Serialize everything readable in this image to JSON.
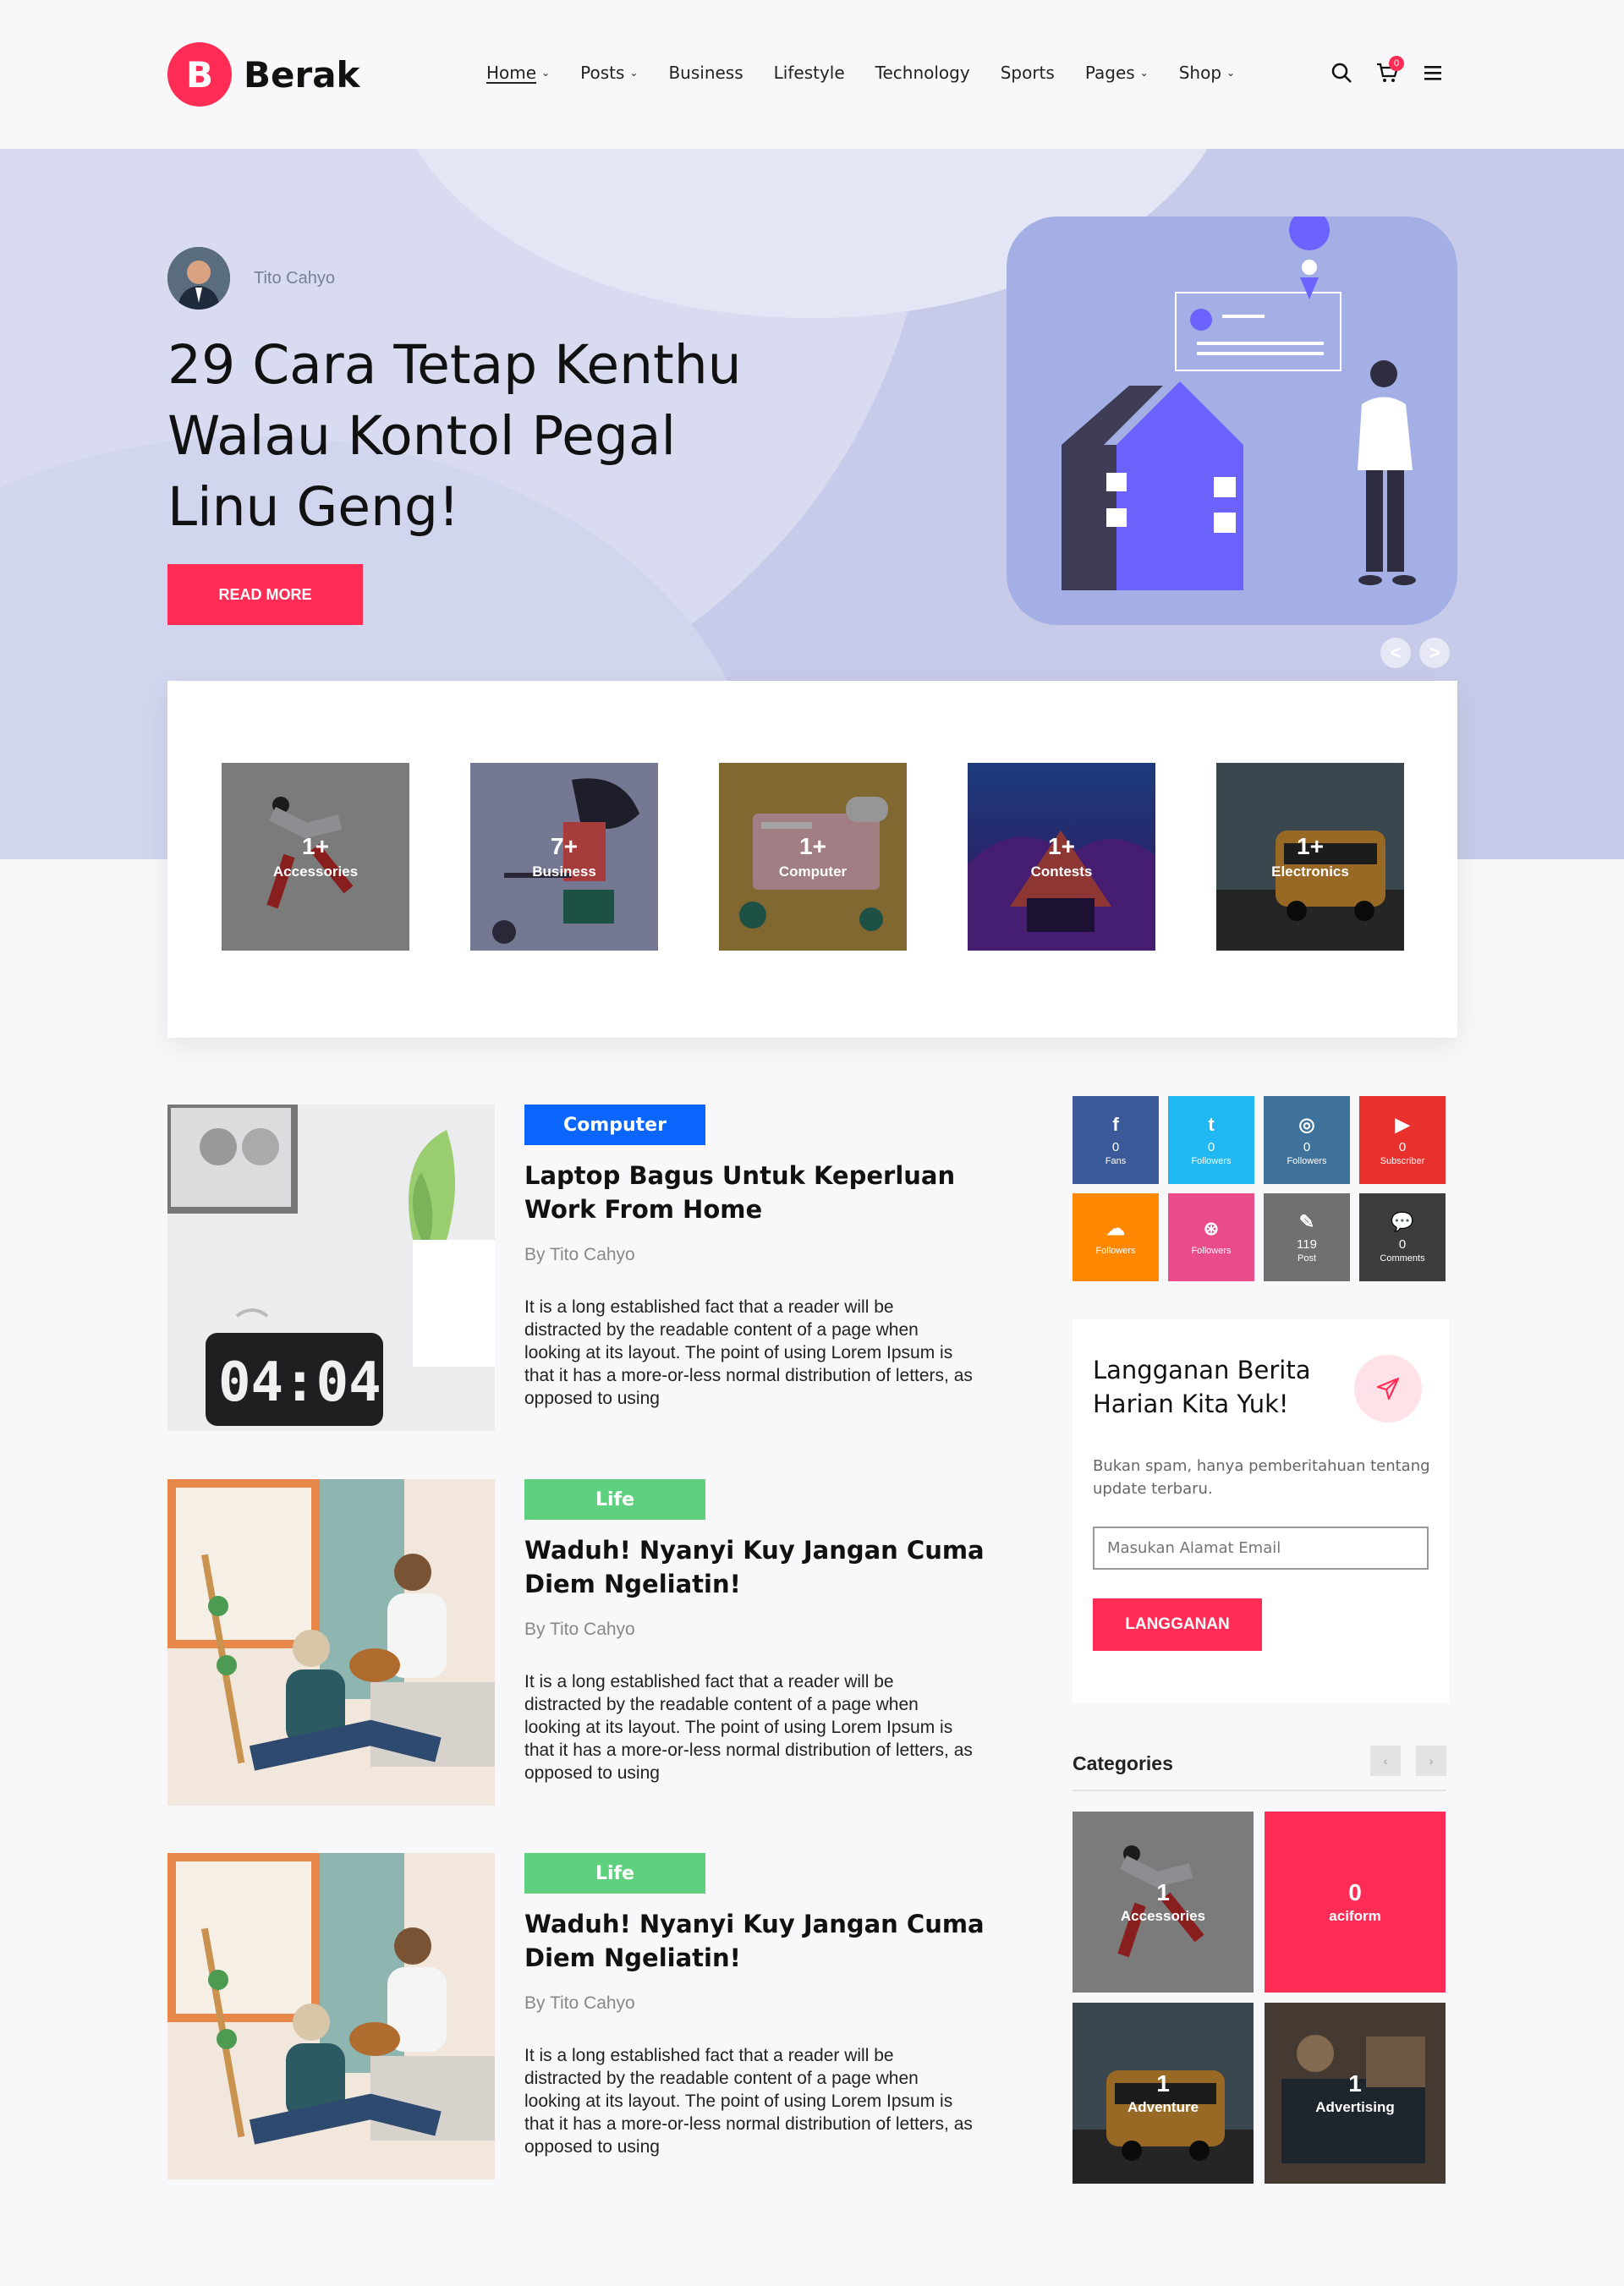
{
  "brand": {
    "logo_letter": "B",
    "name": "Berak"
  },
  "nav": [
    {
      "label": "Home",
      "dropdown": true,
      "active": true
    },
    {
      "label": "Posts",
      "dropdown": true
    },
    {
      "label": "Business",
      "dropdown": false
    },
    {
      "label": "Lifestyle",
      "dropdown": false
    },
    {
      "label": "Technology",
      "dropdown": false
    },
    {
      "label": "Sports",
      "dropdown": false
    },
    {
      "label": "Pages",
      "dropdown": true
    },
    {
      "label": "Shop",
      "dropdown": true
    }
  ],
  "header_icons": {
    "search": "search-icon",
    "cart": "cart-icon",
    "cart_count": "0",
    "menu": "hamburger-menu-icon"
  },
  "hero": {
    "author": "Tito Cahyo",
    "title": "29 Cara Tetap Kenthu Walau Kontol Pegal Linu Geng!",
    "button": "READ MORE",
    "prev": "<",
    "next": ">"
  },
  "category_tiles": [
    {
      "count": "1+",
      "name": "Accessories"
    },
    {
      "count": "7+",
      "name": "Business"
    },
    {
      "count": "1+",
      "name": "Computer"
    },
    {
      "count": "1+",
      "name": "Contests"
    },
    {
      "count": "1+",
      "name": "Electronics"
    }
  ],
  "posts": [
    {
      "tag": "Computer",
      "tag_color": "#0a66ff",
      "title": "Laptop Bagus Untuk Keperluan Work From Home",
      "author": "By Tito Cahyo",
      "excerpt": "It is a long established fact that a reader will be distracted by the readable content of a page when looking at its layout. The point of using Lorem Ipsum is that it has a more-or-less normal distribution of letters, as opposed to using",
      "image_text": "04:04"
    },
    {
      "tag": "Life",
      "tag_color": "#5fd17e",
      "title": "Waduh! Nyanyi Kuy Jangan Cuma Diem Ngeliatin!",
      "author": "By Tito Cahyo",
      "excerpt": "It is a long established fact that a reader will be distracted by the readable content of a page when looking at its layout. The point of using Lorem Ipsum is that it has a more-or-less normal distribution of letters, as opposed to using"
    },
    {
      "tag": "Life",
      "tag_color": "#5fd17e",
      "title": "Waduh! Nyanyi Kuy Jangan Cuma Diem Ngeliatin!",
      "author": "By Tito Cahyo",
      "excerpt": "It is a long established fact that a reader will be distracted by the readable content of a page when looking at its layout. The point of using Lorem Ipsum is that it has a more-or-less normal distribution of letters, as opposed to using"
    }
  ],
  "social": [
    {
      "icon": "facebook-icon",
      "glyph": "f",
      "count": "0",
      "label": "Fans",
      "color": "#3b5a9a"
    },
    {
      "icon": "twitter-icon",
      "glyph": "t",
      "count": "0",
      "label": "Followers",
      "color": "#1fb8f2"
    },
    {
      "icon": "instagram-icon",
      "glyph": "◎",
      "count": "0",
      "label": "Followers",
      "color": "#3f729b"
    },
    {
      "icon": "youtube-icon",
      "glyph": "▶",
      "count": "0",
      "label": "Subscriber",
      "color": "#e8302d"
    },
    {
      "icon": "soundcloud-icon",
      "glyph": "☁",
      "count": "",
      "label": "Followers",
      "color": "#ff8800"
    },
    {
      "icon": "dribbble-icon",
      "glyph": "⊛",
      "count": "",
      "label": "Followers",
      "color": "#ea4c89"
    },
    {
      "icon": "edit-icon",
      "glyph": "✎",
      "count": "119",
      "label": "Post",
      "color": "#707070"
    },
    {
      "icon": "comments-icon",
      "glyph": "💬",
      "count": "0",
      "label": "Comments",
      "color": "#3d3d3d"
    }
  ],
  "newsletter": {
    "title": "Langganan Berita Harian Kita Yuk!",
    "description": "Bukan spam, hanya pemberitahuan tentang update terbaru.",
    "placeholder": "Masukan Alamat Email",
    "button": "LANGGANAN",
    "icon": "send-icon"
  },
  "sidebar_categories": {
    "title": "Categories",
    "prev": "‹",
    "next": "›",
    "items": [
      {
        "count": "1",
        "name": "Accessories"
      },
      {
        "count": "0",
        "name": "aciform",
        "color": "#ff2d55"
      },
      {
        "count": "1",
        "name": "Adventure"
      },
      {
        "count": "1",
        "name": "Advertising"
      }
    ]
  },
  "colors": {
    "accent": "#ff2d55",
    "hero_bg": "#c7cbe9",
    "page_bg": "#f8f8fa"
  }
}
